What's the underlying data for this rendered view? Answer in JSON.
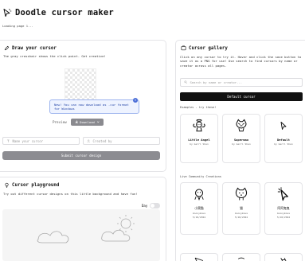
{
  "app": {
    "title": "Doodle cursor maker",
    "loading_text": "Loading page 1..."
  },
  "draw": {
    "heading": "Draw your cursor",
    "description": "The gray crosshair shows the click point. Get creative!",
    "tooltip_text": "New! You can now download as .cur format for Windows",
    "tooltip_close": "×",
    "preview_label": "Preview",
    "download_label": "Download",
    "name_placeholder": "Name your cursor",
    "author_placeholder": "Created by",
    "submit_label": "Submit cursor design"
  },
  "playground": {
    "heading": "Cursor playground",
    "description": "Try out different cursor designs on this little background and have fun!",
    "day_label": "Day",
    "day_mode_on": false
  },
  "gallery": {
    "heading": "Cursor gallery",
    "description": "Click on any cursor to try it. Hover and click the save button to save it as a PNG for use! Use search to find cursors by name or creator across all pages.",
    "search_placeholder": "Search by name or creator...",
    "default_button": "Default cursor",
    "examples_label": "Examples - try these!",
    "examples": [
      {
        "name": "Little Angel",
        "by": "by Gerri Shen"
      },
      {
        "name": "Supermao",
        "by": "by Gerri Shen"
      },
      {
        "name": "Default",
        "by": "by Gerri Shen"
      }
    ],
    "community_label": "Live Community Creations",
    "community": [
      {
        "name": "小黑猫",
        "by": "Anonymous",
        "date": "5/18/2024"
      },
      {
        "name": "猫",
        "by": "Anonymous",
        "date": "5/18/2024"
      },
      {
        "name": "阿阿鬼鬼",
        "by": "Anonymous",
        "date": "5/18/2024"
      }
    ]
  },
  "icons": {
    "logo": "doodle-cursor-icon",
    "draw": "pen-icon",
    "gallery": "gallery-icon",
    "playground": "bulb-icon"
  }
}
